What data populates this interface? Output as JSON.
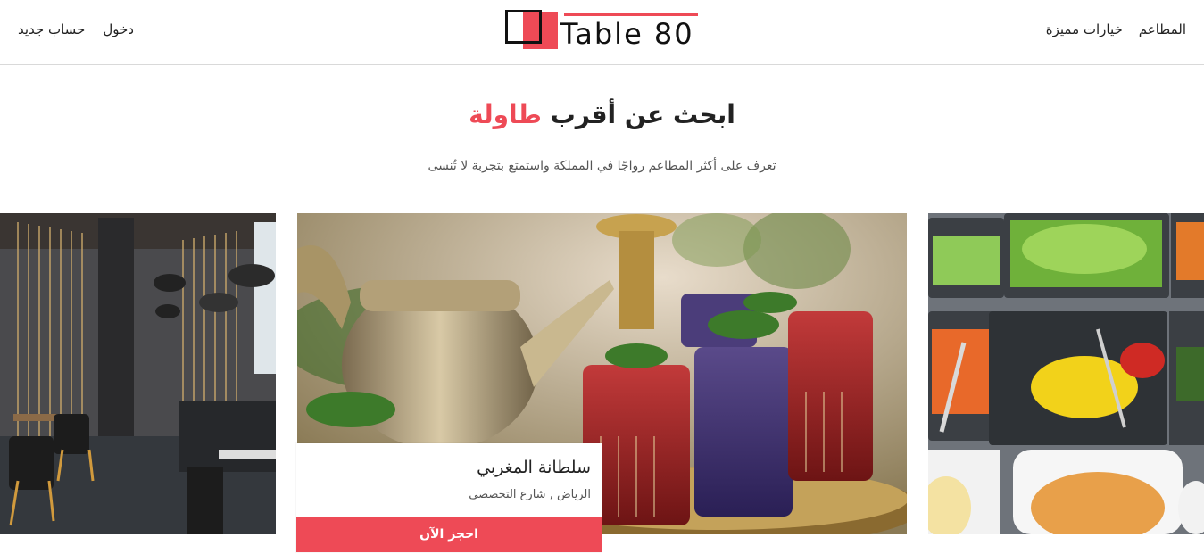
{
  "header": {
    "logo_text": "Table 80",
    "nav_left": [
      "حساب جديد",
      "دخول"
    ],
    "nav_right": [
      "المطاعم",
      "خيارات مميزة"
    ]
  },
  "hero": {
    "title_main": "ابحث عن أقرب",
    "title_accent": "طاولة",
    "subtitle": "تعرف على أكثر المطاعم رواجًا في المملكة واستمتع بتجربة لا تُنسى"
  },
  "featured": {
    "name": "سلطانة المغربي",
    "address": "الرياض , شارع التخصصي",
    "cta": "احجز الآن"
  },
  "colors": {
    "accent": "#ee4a56"
  }
}
